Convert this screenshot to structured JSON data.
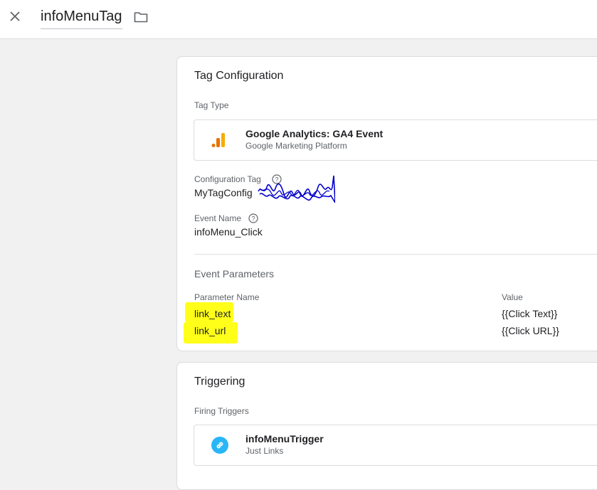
{
  "header": {
    "title": "infoMenuTag"
  },
  "tag_configuration": {
    "title": "Tag Configuration",
    "tag_type_label": "Tag Type",
    "tag_type_name": "Google Analytics: GA4 Event",
    "tag_type_provider": "Google Marketing Platform",
    "config_tag_label": "Configuration Tag",
    "config_tag_value": "MyTagConfig",
    "event_name_label": "Event Name",
    "event_name_value": "infoMenu_Click",
    "event_params_title": "Event Parameters",
    "param_name_header": "Parameter Name",
    "value_header": "Value",
    "params": [
      {
        "name": "link_text",
        "value": "{{Click Text}}"
      },
      {
        "name": "link_url",
        "value": "{{Click URL}}"
      }
    ]
  },
  "triggering": {
    "title": "Triggering",
    "firing_label": "Firing Triggers",
    "trigger_name": "infoMenuTrigger",
    "trigger_type": "Just Links"
  },
  "colors": {
    "analytics_orange": "#f9ab00",
    "analytics_dark_orange": "#e37400",
    "trigger_blue": "#29b6f6",
    "highlight_yellow": "#ffff1a",
    "scribble_blue": "#0000cc"
  }
}
